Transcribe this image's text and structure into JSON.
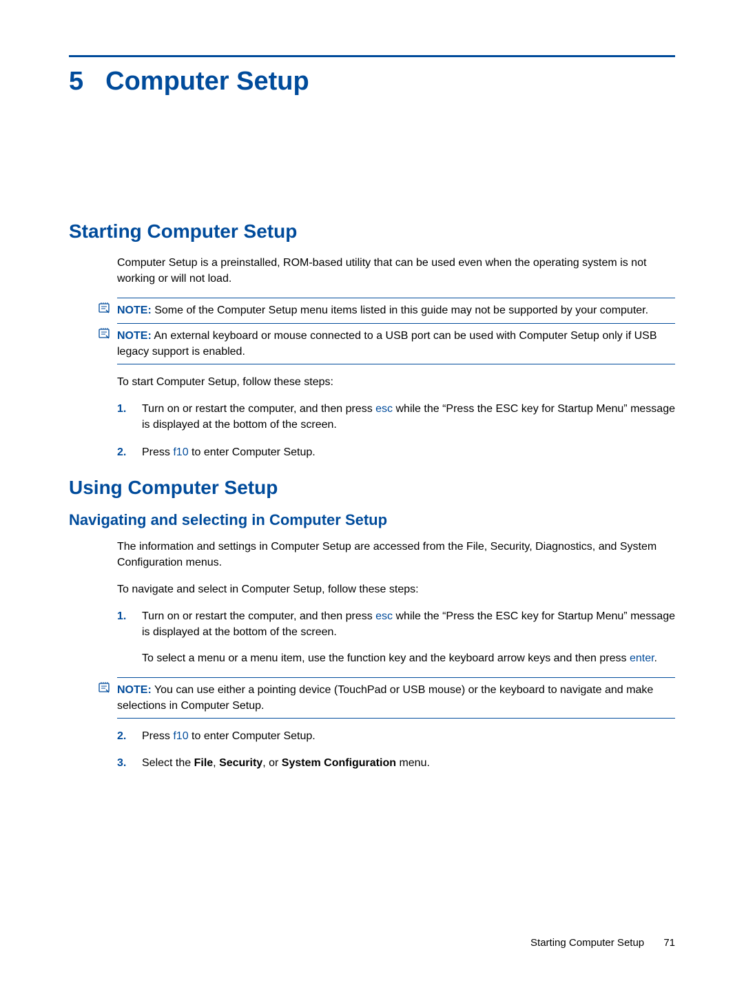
{
  "chapter": {
    "number": "5",
    "title": "Computer Setup"
  },
  "section1": {
    "heading": "Starting Computer Setup",
    "intro": "Computer Setup is a preinstalled, ROM-based utility that can be used even when the operating system is not working or will not load.",
    "note1": {
      "label": "NOTE:",
      "text": "Some of the Computer Setup menu items listed in this guide may not be supported by your computer."
    },
    "note2": {
      "label": "NOTE:",
      "text": "An external keyboard or mouse connected to a USB port can be used with Computer Setup only if USB legacy support is enabled."
    },
    "lead": "To start Computer Setup, follow these steps:",
    "steps": {
      "s1a": "Turn on or restart the computer, and then press ",
      "s1key": "esc",
      "s1b": " while the “Press the ESC key for Startup Menu” message is displayed at the bottom of the screen.",
      "s2a": "Press ",
      "s2key": "f10",
      "s2b": " to enter Computer Setup."
    }
  },
  "section2": {
    "heading": "Using Computer Setup",
    "sub1": {
      "heading": "Navigating and selecting in Computer Setup",
      "p1": "The information and settings in Computer Setup are accessed from the File, Security, Diagnostics, and System Configuration menus.",
      "p2": "To navigate and select in Computer Setup, follow these steps:",
      "steps": {
        "s1a": "Turn on or restart the computer, and then press ",
        "s1key": "esc",
        "s1b": " while the “Press the ESC key for Startup Menu” message is displayed at the bottom of the screen.",
        "s1sub_a": "To select a menu or a menu item, use the function key and the keyboard arrow keys and then press ",
        "s1sub_key": "enter",
        "s1sub_b": ".",
        "note": {
          "label": "NOTE:",
          "text": "You can use either a pointing device (TouchPad or USB mouse) or the keyboard to navigate and make selections in Computer Setup."
        },
        "s2a": "Press ",
        "s2key": "f10",
        "s2b": " to enter Computer Setup.",
        "s3a": "Select the ",
        "s3b1": "File",
        "s3c": ", ",
        "s3b2": "Security",
        "s3d": ", or ",
        "s3b3": "System Configuration",
        "s3e": " menu."
      }
    }
  },
  "footer": {
    "section": "Starting Computer Setup",
    "page": "71"
  }
}
